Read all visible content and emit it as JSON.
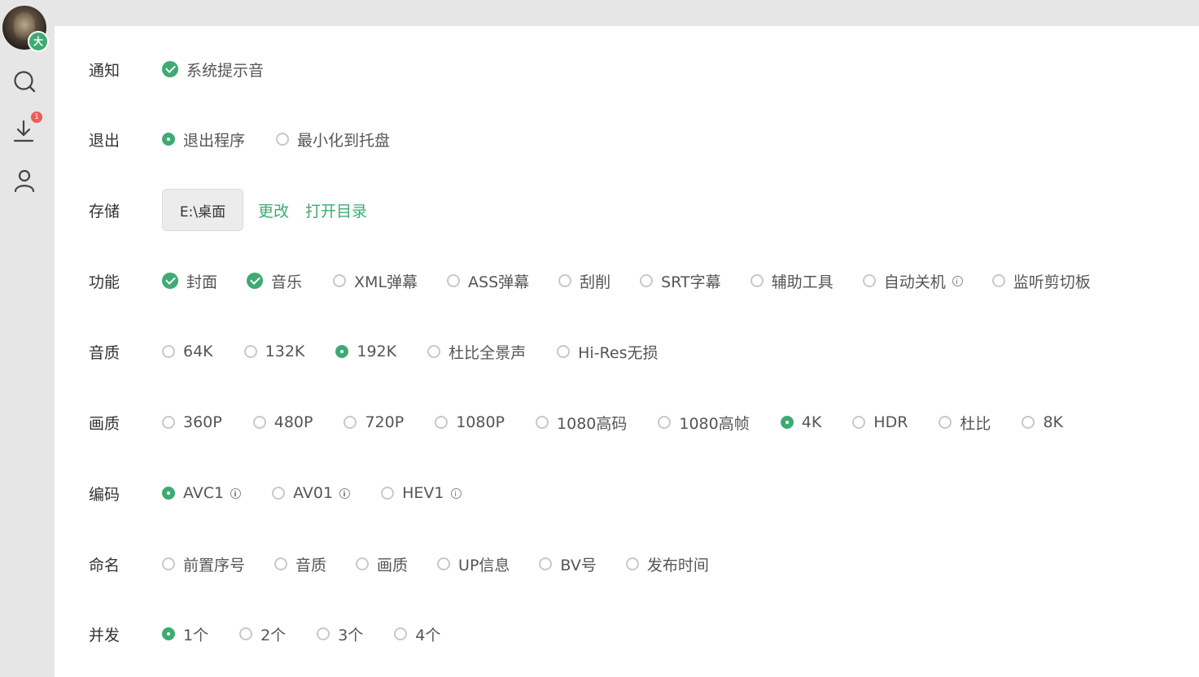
{
  "sidebar": {
    "avatar_badge": "大",
    "download_badge": "1",
    "icons": [
      "search-icon",
      "download-icon",
      "user-icon"
    ]
  },
  "colors": {
    "accent": "#3dab72",
    "badge_red": "#f05a5a"
  },
  "settings": {
    "notify": {
      "label": "通知",
      "options": [
        {
          "text": "系统提示音",
          "checked": true
        }
      ]
    },
    "exit": {
      "label": "退出",
      "options": [
        {
          "text": "退出程序",
          "checked": true
        },
        {
          "text": "最小化到托盘",
          "checked": false
        }
      ]
    },
    "storage": {
      "label": "存储",
      "path": "E:\\桌面",
      "change": "更改",
      "open_dir": "打开目录"
    },
    "features": {
      "label": "功能",
      "options": [
        {
          "text": "封面",
          "checked": true
        },
        {
          "text": "音乐",
          "checked": true
        },
        {
          "text": "XML弹幕",
          "checked": false
        },
        {
          "text": "ASS弹幕",
          "checked": false
        },
        {
          "text": "刮削",
          "checked": false
        },
        {
          "text": "SRT字幕",
          "checked": false
        },
        {
          "text": "辅助工具",
          "checked": false
        },
        {
          "text": "自动关机",
          "checked": false,
          "info": true
        },
        {
          "text": "监听剪切板",
          "checked": false
        }
      ]
    },
    "audio": {
      "label": "音质",
      "options": [
        {
          "text": "64K",
          "checked": false
        },
        {
          "text": "132K",
          "checked": false
        },
        {
          "text": "192K",
          "checked": true
        },
        {
          "text": "杜比全景声",
          "checked": false
        },
        {
          "text": "Hi-Res无损",
          "checked": false
        }
      ]
    },
    "video": {
      "label": "画质",
      "options": [
        {
          "text": "360P",
          "checked": false
        },
        {
          "text": "480P",
          "checked": false
        },
        {
          "text": "720P",
          "checked": false
        },
        {
          "text": "1080P",
          "checked": false
        },
        {
          "text": "1080高码",
          "checked": false
        },
        {
          "text": "1080高帧",
          "checked": false
        },
        {
          "text": "4K",
          "checked": true
        },
        {
          "text": "HDR",
          "checked": false
        },
        {
          "text": "杜比",
          "checked": false
        },
        {
          "text": "8K",
          "checked": false
        }
      ]
    },
    "codec": {
      "label": "编码",
      "options": [
        {
          "text": "AVC1",
          "checked": true,
          "info": true
        },
        {
          "text": "AV01",
          "checked": false,
          "info": true
        },
        {
          "text": "HEV1",
          "checked": false,
          "info": true
        }
      ]
    },
    "naming": {
      "label": "命名",
      "options": [
        {
          "text": "前置序号",
          "checked": false
        },
        {
          "text": "音质",
          "checked": false
        },
        {
          "text": "画质",
          "checked": false
        },
        {
          "text": "UP信息",
          "checked": false
        },
        {
          "text": "BV号",
          "checked": false
        },
        {
          "text": "发布时间",
          "checked": false
        }
      ]
    },
    "concurrency": {
      "label": "并发",
      "options": [
        {
          "text": "1个",
          "checked": true
        },
        {
          "text": "2个",
          "checked": false
        },
        {
          "text": "3个",
          "checked": false
        },
        {
          "text": "4个",
          "checked": false
        }
      ]
    }
  }
}
